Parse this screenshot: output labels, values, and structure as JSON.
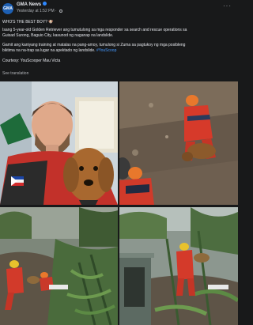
{
  "post": {
    "page_name": "GMA News",
    "timestamp": "Yesterday at 1:52 PM",
    "avatar_text": "GMA",
    "caption_lines": [
      "WHO'S THE BEST BOY? 🐶",
      "Isang 5-year-old Golden Retriever ang tumutulong sa mga responder sa search and rescue operations sa",
      "Guisad Surong, Baguio City, kasunod ng naganap na landslide.",
      "Gamit ang kaniyang training at matalas na pang-amoy, tumulong si Zuma sa pagtukoy ng mga posibleng",
      "biktima na na-trap sa lugar na apektado ng landslide."
    ],
    "hashtag": "#YouScoop",
    "courtesy": "Courtesy: YouScooper Mau Victa",
    "see_translation": "See translation",
    "more_label": "···"
  },
  "colors": {
    "background": "#18191a",
    "text": "#e4e6eb",
    "muted": "#b0b3b8",
    "link": "#4599ff",
    "rescue_orange": "#e2452c"
  }
}
